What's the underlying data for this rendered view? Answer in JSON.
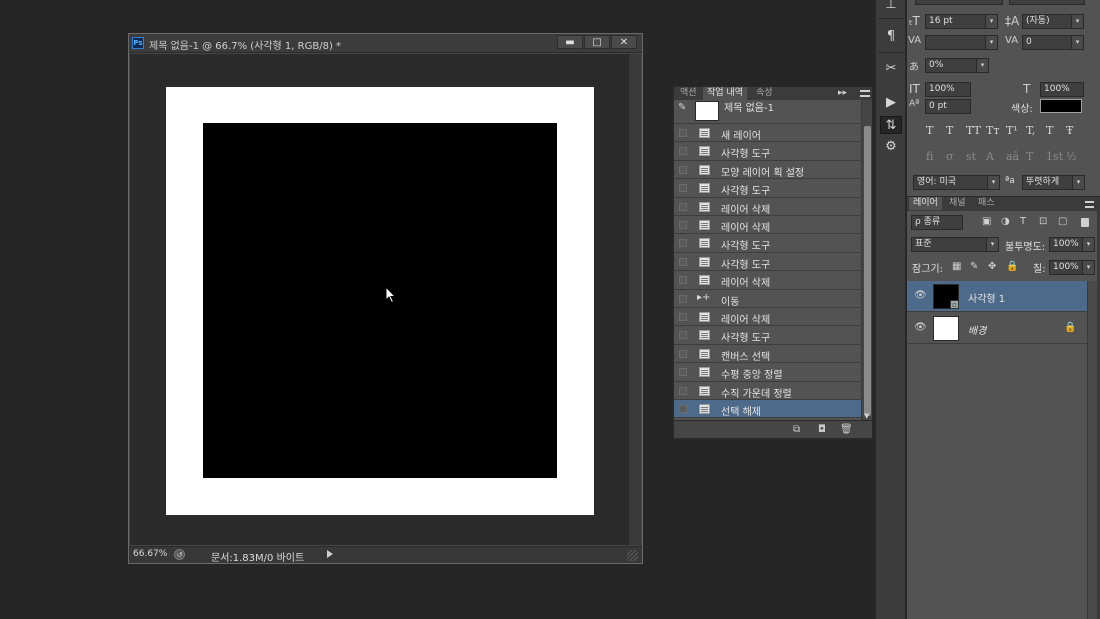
{
  "document": {
    "title": "제목 없음-1 @ 66.7% (사각형 1, RGB/8) *",
    "app_logo": "Ps",
    "window_buttons": {
      "minimize": "▬",
      "restore": "□",
      "close": "✕"
    },
    "zoom": "66.67%",
    "status_icon": "↺",
    "doc_info": "문서:1.83M/0 바이트"
  },
  "history_panel": {
    "tabs": [
      "액션",
      "작업 내역",
      "속성"
    ],
    "active_tab": 1,
    "arrows": "▸▸",
    "snapshot_label": "제목 없음-1",
    "brush_icon": "✎",
    "items": [
      "새 레이어",
      "사각형 도구",
      "모양 레이어 획 설정",
      "사각형 도구",
      "레이어 삭제",
      "레이어 삭제",
      "사각형 도구",
      "사각형 도구",
      "레이어 삭제",
      "이동",
      "레이어 삭제",
      "사각형 도구",
      "캔버스 선택",
      "수평 중앙 정렬",
      "수직 가운데 정렬",
      "선택 해제"
    ],
    "selected_index": 15,
    "move_icon": "▸+",
    "scroll_down": "▼",
    "footer_buttons": [
      "⧉",
      "◘",
      "🗑"
    ]
  },
  "toolstrip": [
    "⊥",
    "¶",
    "✂",
    "▶",
    "⇅",
    "⚙"
  ],
  "character_panel": {
    "font_size": "16 pt",
    "leading": "(자동)",
    "kerning": "",
    "tracking": "0",
    "scale_pct": "0%",
    "vertical_scale": "100%",
    "horizontal_scale": "100%",
    "baseline_shift": "0 pt",
    "color_label": "색상:",
    "color": "#000000",
    "language": "영어: 미국",
    "antialias_icon": "ªa",
    "antialias": "뚜렷하게",
    "type_styles": [
      "T",
      "T",
      "TT",
      "Tт",
      "T¹",
      "T,",
      "T",
      "Ŧ"
    ],
    "opentype": [
      "ﬁ",
      "σ",
      "st",
      "A",
      "aā",
      "T",
      "1st",
      "½"
    ],
    "labels": {
      "font_size_icon": "ₜT",
      "leading_icon": "‡A",
      "kerning_icon": "VA",
      "tracking_icon": "VA",
      "scale_icon": "あ",
      "vscale_icon": "IT",
      "hscale_icon": "T",
      "baseline_icon": "Aª"
    }
  },
  "layers_panel": {
    "tabs": [
      "레이어",
      "채널",
      "패스"
    ],
    "active_tab": 0,
    "filter": "ρ 종류",
    "filter_icons": [
      "▣",
      "◑",
      "T",
      "⊡",
      "▢"
    ],
    "blend_mode": "표준",
    "opacity_label": "불투명도:",
    "opacity": "100%",
    "lock_label": "잠그기:",
    "lock_icons": [
      "▦",
      "✎",
      "✥",
      "🔒"
    ],
    "fill_label": "칠:",
    "fill": "100%",
    "layers": [
      {
        "name": "사각형 1",
        "thumb_color": "#000000",
        "selected": true,
        "italic": false,
        "locked": false
      },
      {
        "name": "배경",
        "thumb_color": "#ffffff",
        "selected": false,
        "italic": true,
        "locked": true
      }
    ],
    "eye_icon": "👁",
    "lock_icon": "🔒",
    "dropdown_arrow": "▾",
    "shape_badge": "▫"
  },
  "colors": {
    "selection_blue": "#4e6a8a",
    "panel_bg": "#535353",
    "workspace_bg": "#262626"
  }
}
